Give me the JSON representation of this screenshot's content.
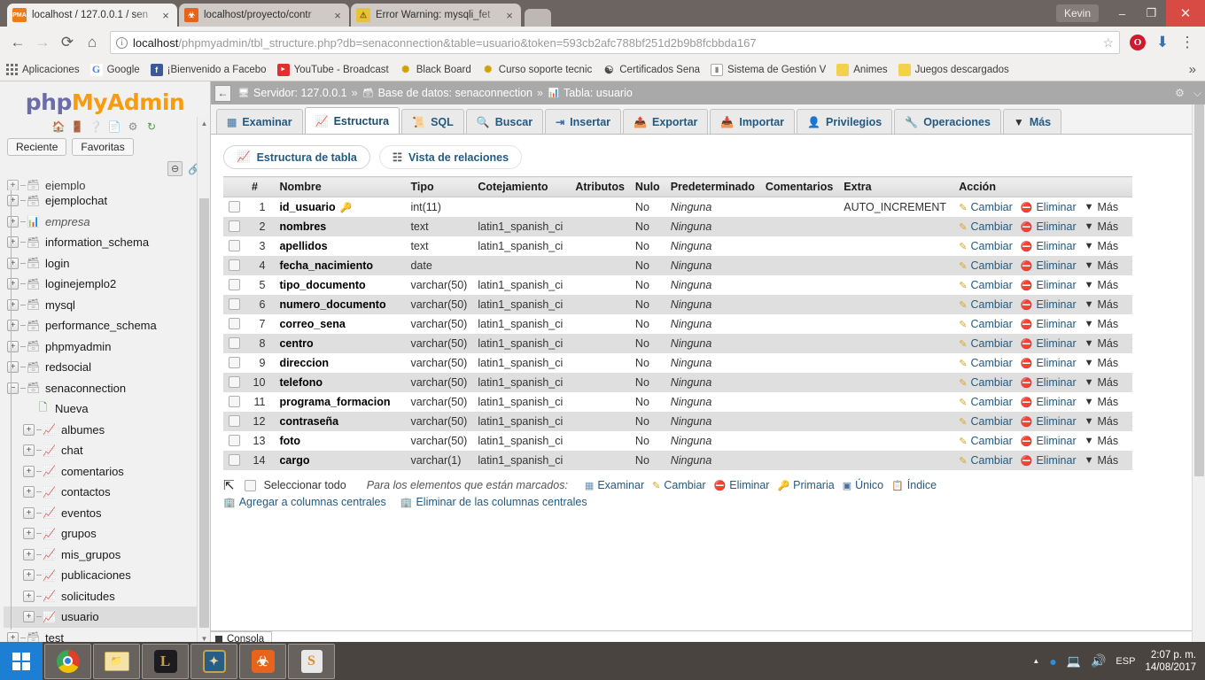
{
  "browser": {
    "tabs": [
      {
        "title": "localhost / 127.0.0.1 / sen",
        "favicon": "pma-icon",
        "active": true,
        "close": "×"
      },
      {
        "title": "localhost/proyecto/contr",
        "favicon": "xampp-icon",
        "active": false,
        "close": "×"
      },
      {
        "title": "Error Warning: mysqli_fet",
        "favicon": "warning-icon",
        "active": false,
        "close": "×"
      }
    ],
    "window": {
      "user": "Kevin",
      "minimize": "–",
      "maximize": "❐",
      "close": "✕"
    },
    "nav": {
      "back": "←",
      "forward": "→",
      "reload": "⟳",
      "home": "⌂",
      "menu": "⋮"
    },
    "omnibox": {
      "info_icon": "i",
      "host": "localhost",
      "path": "/phpmyadmin/tbl_structure.php?db=senaconnection&table=usuario&token=593cb2afc788bf251d2b9b8fcbbda167",
      "star": "☆"
    },
    "bookmarks": [
      {
        "label": "Aplicaciones",
        "icon": "apps-grid-icon"
      },
      {
        "label": "Google",
        "icon": "google-icon"
      },
      {
        "label": "¡Bienvenido a Facebo",
        "icon": "facebook-icon"
      },
      {
        "label": "YouTube - Broadcast",
        "icon": "youtube-icon"
      },
      {
        "label": "Black Board",
        "icon": "blackboard-icon"
      },
      {
        "label": "Curso soporte tecnic",
        "icon": "course-icon"
      },
      {
        "label": "Certificados Sena",
        "icon": "sena-icon"
      },
      {
        "label": "Sistema de Gestión V",
        "icon": "document-icon"
      },
      {
        "label": "Animes",
        "icon": "folder-icon"
      },
      {
        "label": "Juegos descargados",
        "icon": "folder-icon"
      }
    ],
    "bookmarks_overflow": "»"
  },
  "sidebar": {
    "logo": {
      "php": "php",
      "my": "My",
      "admin": "Admin"
    },
    "logo_icons": [
      "home-icon",
      "exit-icon",
      "help-icon",
      "docs-icon",
      "settings-icon",
      "reload-icon"
    ],
    "recent_label": "Reciente",
    "favorites_label": "Favoritas",
    "collapse_icon": "collapse-icon",
    "link_icon": "link-icon",
    "tree": [
      {
        "label": "ejemplo",
        "level": "db",
        "expander": "+",
        "icon": "db-icon",
        "cut": true
      },
      {
        "label": "ejemplochat",
        "level": "db",
        "expander": "+",
        "icon": "db-icon"
      },
      {
        "label": "empresa",
        "level": "db",
        "expander": "+",
        "icon": "db-table-icon",
        "italic": true
      },
      {
        "label": "information_schema",
        "level": "db",
        "expander": "+",
        "icon": "db-icon"
      },
      {
        "label": "login",
        "level": "db",
        "expander": "+",
        "icon": "db-icon"
      },
      {
        "label": "loginejemplo2",
        "level": "db",
        "expander": "+",
        "icon": "db-icon"
      },
      {
        "label": "mysql",
        "level": "db",
        "expander": "+",
        "icon": "db-icon"
      },
      {
        "label": "performance_schema",
        "level": "db",
        "expander": "+",
        "icon": "db-icon"
      },
      {
        "label": "phpmyadmin",
        "level": "db",
        "expander": "+",
        "icon": "db-icon"
      },
      {
        "label": "redsocial",
        "level": "db",
        "expander": "+",
        "icon": "db-icon"
      },
      {
        "label": "senaconnection",
        "level": "db",
        "expander": "−",
        "icon": "db-icon"
      },
      {
        "label": "Nueva",
        "level": "new",
        "expander": "",
        "icon": "new-table-icon"
      },
      {
        "label": "albumes",
        "level": "table",
        "expander": "+",
        "icon": "table-icon"
      },
      {
        "label": "chat",
        "level": "table",
        "expander": "+",
        "icon": "table-icon"
      },
      {
        "label": "comentarios",
        "level": "table",
        "expander": "+",
        "icon": "table-icon"
      },
      {
        "label": "contactos",
        "level": "table",
        "expander": "+",
        "icon": "table-icon"
      },
      {
        "label": "eventos",
        "level": "table",
        "expander": "+",
        "icon": "table-icon"
      },
      {
        "label": "grupos",
        "level": "table",
        "expander": "+",
        "icon": "table-icon"
      },
      {
        "label": "mis_grupos",
        "level": "table",
        "expander": "+",
        "icon": "table-icon"
      },
      {
        "label": "publicaciones",
        "level": "table",
        "expander": "+",
        "icon": "table-icon"
      },
      {
        "label": "solicitudes",
        "level": "table",
        "expander": "+",
        "icon": "table-icon"
      },
      {
        "label": "usuario",
        "level": "table",
        "expander": "+",
        "icon": "table-icon",
        "selected": true
      },
      {
        "label": "test",
        "level": "db",
        "expander": "+",
        "icon": "db-icon"
      }
    ]
  },
  "main": {
    "breadcrumb": {
      "back": "←",
      "server_label": "Servidor: 127.0.0.1",
      "db_label": "Base de datos: senaconnection",
      "table_label": "Tabla: usuario",
      "separator": "»",
      "settings_icon": "gear-icon",
      "collapse_icon": "collapse-up-icon"
    },
    "tabs": [
      {
        "label": "Examinar",
        "icon": "browse-icon",
        "active": false
      },
      {
        "label": "Estructura",
        "icon": "structure-icon",
        "active": true
      },
      {
        "label": "SQL",
        "icon": "sql-icon",
        "active": false
      },
      {
        "label": "Buscar",
        "icon": "search-icon",
        "active": false
      },
      {
        "label": "Insertar",
        "icon": "insert-icon",
        "active": false
      },
      {
        "label": "Exportar",
        "icon": "export-icon",
        "active": false
      },
      {
        "label": "Importar",
        "icon": "import-icon",
        "active": false
      },
      {
        "label": "Privilegios",
        "icon": "privileges-icon",
        "active": false
      },
      {
        "label": "Operaciones",
        "icon": "operations-icon",
        "active": false
      },
      {
        "label": "Más",
        "icon": "chevron-down-icon",
        "active": false
      }
    ],
    "subtabs": [
      {
        "label": "Estructura de tabla",
        "icon": "structure-icon",
        "active": true
      },
      {
        "label": "Vista de relaciones",
        "icon": "relations-icon",
        "active": false
      }
    ],
    "table": {
      "headers": [
        "",
        "#",
        "Nombre",
        "Tipo",
        "Cotejamiento",
        "Atributos",
        "Nulo",
        "Predeterminado",
        "Comentarios",
        "Extra",
        "Acción"
      ],
      "action_labels": {
        "change": "Cambiar",
        "drop": "Eliminar",
        "more": "Más"
      },
      "rows": [
        {
          "num": "1",
          "name": "id_usuario",
          "primary": true,
          "type": "int(11)",
          "collation": "",
          "attributes": "",
          "null": "No",
          "default": "Ninguna",
          "comments": "",
          "extra": "AUTO_INCREMENT"
        },
        {
          "num": "2",
          "name": "nombres",
          "primary": false,
          "type": "text",
          "collation": "latin1_spanish_ci",
          "attributes": "",
          "null": "No",
          "default": "Ninguna",
          "comments": "",
          "extra": ""
        },
        {
          "num": "3",
          "name": "apellidos",
          "primary": false,
          "type": "text",
          "collation": "latin1_spanish_ci",
          "attributes": "",
          "null": "No",
          "default": "Ninguna",
          "comments": "",
          "extra": ""
        },
        {
          "num": "4",
          "name": "fecha_nacimiento",
          "primary": false,
          "type": "date",
          "collation": "",
          "attributes": "",
          "null": "No",
          "default": "Ninguna",
          "comments": "",
          "extra": ""
        },
        {
          "num": "5",
          "name": "tipo_documento",
          "primary": false,
          "type": "varchar(50)",
          "collation": "latin1_spanish_ci",
          "attributes": "",
          "null": "No",
          "default": "Ninguna",
          "comments": "",
          "extra": ""
        },
        {
          "num": "6",
          "name": "numero_documento",
          "primary": false,
          "type": "varchar(50)",
          "collation": "latin1_spanish_ci",
          "attributes": "",
          "null": "No",
          "default": "Ninguna",
          "comments": "",
          "extra": ""
        },
        {
          "num": "7",
          "name": "correo_sena",
          "primary": false,
          "type": "varchar(50)",
          "collation": "latin1_spanish_ci",
          "attributes": "",
          "null": "No",
          "default": "Ninguna",
          "comments": "",
          "extra": ""
        },
        {
          "num": "8",
          "name": "centro",
          "primary": false,
          "type": "varchar(50)",
          "collation": "latin1_spanish_ci",
          "attributes": "",
          "null": "No",
          "default": "Ninguna",
          "comments": "",
          "extra": ""
        },
        {
          "num": "9",
          "name": "direccion",
          "primary": false,
          "type": "varchar(50)",
          "collation": "latin1_spanish_ci",
          "attributes": "",
          "null": "No",
          "default": "Ninguna",
          "comments": "",
          "extra": ""
        },
        {
          "num": "10",
          "name": "telefono",
          "primary": false,
          "type": "varchar(50)",
          "collation": "latin1_spanish_ci",
          "attributes": "",
          "null": "No",
          "default": "Ninguna",
          "comments": "",
          "extra": ""
        },
        {
          "num": "11",
          "name": "programa_formacion",
          "primary": false,
          "type": "varchar(50)",
          "collation": "latin1_spanish_ci",
          "attributes": "",
          "null": "No",
          "default": "Ninguna",
          "comments": "",
          "extra": ""
        },
        {
          "num": "12",
          "name": "contraseña",
          "primary": false,
          "type": "varchar(50)",
          "collation": "latin1_spanish_ci",
          "attributes": "",
          "null": "No",
          "default": "Ninguna",
          "comments": "",
          "extra": ""
        },
        {
          "num": "13",
          "name": "foto",
          "primary": false,
          "type": "varchar(50)",
          "collation": "latin1_spanish_ci",
          "attributes": "",
          "null": "No",
          "default": "Ninguna",
          "comments": "",
          "extra": ""
        },
        {
          "num": "14",
          "name": "cargo",
          "primary": false,
          "type": "varchar(1)",
          "collation": "latin1_spanish_ci",
          "attributes": "",
          "null": "No",
          "default": "Ninguna",
          "comments": "",
          "extra": ""
        }
      ]
    },
    "footer": {
      "select_all": "Seleccionar todo",
      "marked_prefix": "Para los elementos que están marcados:",
      "actions": [
        {
          "label": "Examinar",
          "icon": "browse-icon"
        },
        {
          "label": "Cambiar",
          "icon": "pencil-icon"
        },
        {
          "label": "Eliminar",
          "icon": "delete-icon"
        },
        {
          "label": "Primaria",
          "icon": "key-icon"
        },
        {
          "label": "Único",
          "icon": "unique-icon"
        },
        {
          "label": "Índice",
          "icon": "index-icon"
        }
      ],
      "central_add": "Agregar a columnas centrales",
      "central_remove": "Eliminar de las columnas centrales"
    },
    "console": {
      "label": "Consola",
      "icon": "console-icon"
    }
  },
  "taskbar": {
    "start": "windows-logo-icon",
    "items": [
      {
        "name": "chrome",
        "running": true
      },
      {
        "name": "file-explorer",
        "running": true
      },
      {
        "name": "league-of-legends",
        "running": true
      },
      {
        "name": "hearthstone",
        "running": true
      },
      {
        "name": "xampp",
        "running": true
      },
      {
        "name": "sublime-text",
        "running": true
      }
    ],
    "tray": {
      "expand": "▲",
      "icons": [
        "antivirus-icon",
        "network-icon",
        "volume-icon"
      ],
      "language": "ESP",
      "time": "2:07 p. m.",
      "date": "14/08/2017"
    }
  }
}
